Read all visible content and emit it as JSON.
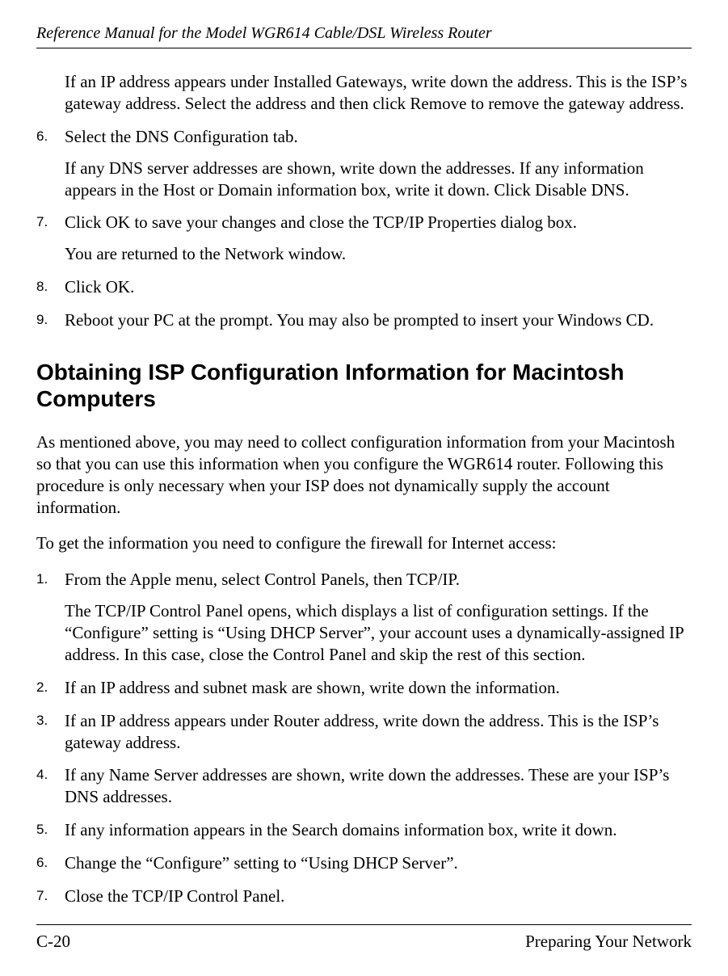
{
  "header": {
    "running_title": "Reference Manual for the Model WGR614 Cable/DSL Wireless Router"
  },
  "top_continuation": {
    "text": "If an IP address appears under Installed Gateways, write down the address. This is the ISP’s gateway address. Select the address and then click Remove to remove the gateway address."
  },
  "list_a": [
    {
      "marker": "6.",
      "paras": [
        "Select the DNS Configuration tab.",
        "If any DNS server addresses are shown, write down the addresses. If any information appears in the Host or Domain information box, write it down. Click Disable DNS."
      ]
    },
    {
      "marker": "7.",
      "paras": [
        "Click OK to save your changes and close the TCP/IP Properties dialog box.",
        "You are returned to the Network window."
      ]
    },
    {
      "marker": "8.",
      "paras": [
        "Click OK."
      ]
    },
    {
      "marker": "9.",
      "paras": [
        "Reboot your PC at the prompt. You may also be prompted to insert your Windows CD."
      ]
    }
  ],
  "section": {
    "title": "Obtaining ISP Configuration Information for Macintosh Computers",
    "intro": "As mentioned above, you may need to collect configuration information from your Macintosh so that you can use this information when you configure the WGR614 router. Following this procedure is only necessary when your ISP does not dynamically supply the account information.",
    "lead": "To get the information you need to configure the firewall for Internet access:"
  },
  "list_b": [
    {
      "marker": "1.",
      "paras": [
        "From the Apple menu, select Control Panels, then TCP/IP.",
        "The TCP/IP Control Panel opens, which displays a list of configuration settings. If the “Configure” setting is “Using DHCP Server”, your account uses a dynamically-assigned IP address. In this case, close the Control Panel and skip the rest of this section."
      ]
    },
    {
      "marker": "2.",
      "paras": [
        "If an IP address and subnet mask are shown, write down the information."
      ]
    },
    {
      "marker": "3.",
      "paras": [
        "If an IP address appears under Router address, write down the address. This is the ISP’s gateway address."
      ]
    },
    {
      "marker": "4.",
      "paras": [
        "If any Name Server addresses are shown, write down the addresses. These are your ISP’s DNS addresses."
      ]
    },
    {
      "marker": "5.",
      "paras": [
        "If any information appears in the Search domains information box, write it down."
      ]
    },
    {
      "marker": "6.",
      "paras": [
        "Change the “Configure” setting to “Using DHCP Server”."
      ]
    },
    {
      "marker": "7.",
      "paras": [
        "Close the TCP/IP Control Panel."
      ]
    }
  ],
  "footer": {
    "left": "C-20",
    "right": "Preparing Your Network"
  }
}
